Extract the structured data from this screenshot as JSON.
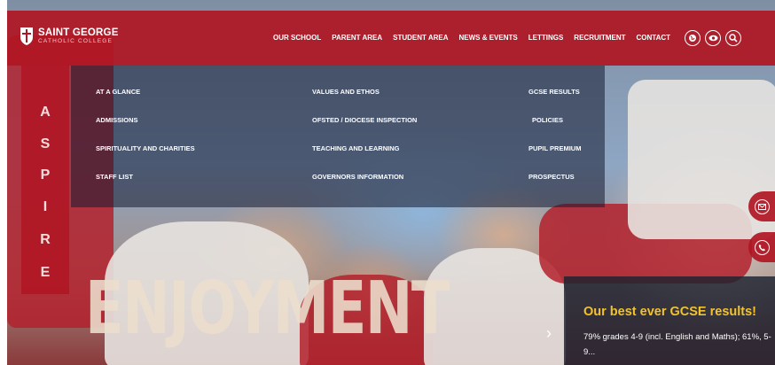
{
  "brand": {
    "name_line1": "SAINT GEORGE",
    "name_line2": "CATHOLIC COLLEGE",
    "accent": "#b01623"
  },
  "nav": {
    "items": [
      "OUR SCHOOL",
      "PARENT AREA",
      "STUDENT AREA",
      "NEWS & EVENTS",
      "LETTINGS",
      "RECRUITMENT",
      "CONTACT"
    ],
    "icons": [
      "globe-icon",
      "eye-icon",
      "search-icon"
    ]
  },
  "mega_menu": {
    "col1": [
      "AT A GLANCE",
      "ADMISSIONS",
      "SPIRITUALITY AND CHARITIES",
      "STAFF LIST"
    ],
    "col2": [
      "VALUES AND ETHOS",
      "OFSTED / DIOCESE INSPECTION",
      "TEACHING AND LEARNING",
      "GOVERNORS INFORMATION"
    ],
    "col3": [
      "GCSE RESULTS",
      "POLICIES",
      "PUPIL PREMIUM",
      "PROSPECTUS"
    ]
  },
  "aspire_letters": [
    "A",
    "S",
    "P",
    "I",
    "R",
    "E"
  ],
  "hero_word": "ENJOYMENT",
  "side_buttons": [
    "mail-icon",
    "phone-icon"
  ],
  "news": {
    "title": "Our best ever GCSE results!",
    "body": "79% grades 4-9 (incl. English and Maths); 61%, 5-9...",
    "title_color": "#f2c32e"
  }
}
